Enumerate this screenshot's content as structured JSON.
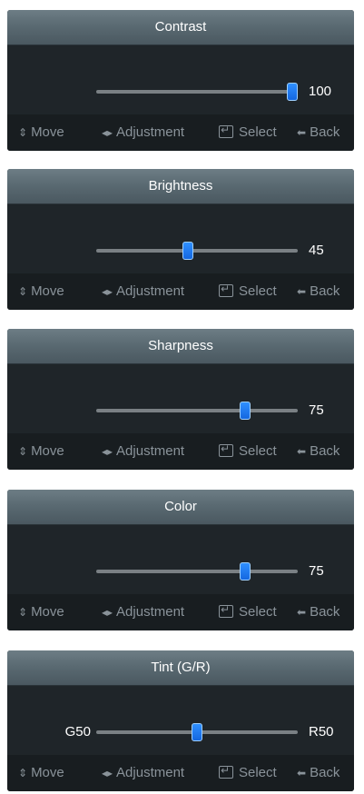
{
  "footer": {
    "move_icon": "up-down-arrows-icon",
    "move_label": "Move",
    "adjust_icon": "left-right-arrows-icon",
    "adjust_label": "Adjustment",
    "select_icon": "enter-icon",
    "select_label": "Select",
    "back_icon": "left-arrow-icon",
    "back_label": "Back"
  },
  "panels": [
    {
      "title": "Contrast",
      "value": "100",
      "level": 100
    },
    {
      "title": "Brightness",
      "value": "45",
      "level": 45
    },
    {
      "title": "Sharpness",
      "value": "75",
      "level": 75
    },
    {
      "title": "Color",
      "value": "75",
      "level": 75
    },
    {
      "title": "Tint (G/R)",
      "left_value": "G50",
      "right_value": "R50",
      "level": 50
    }
  ],
  "colors": {
    "accent": "#1f7bf5",
    "panel_bg": "#1e2428",
    "footer_text": "#8a939a"
  }
}
